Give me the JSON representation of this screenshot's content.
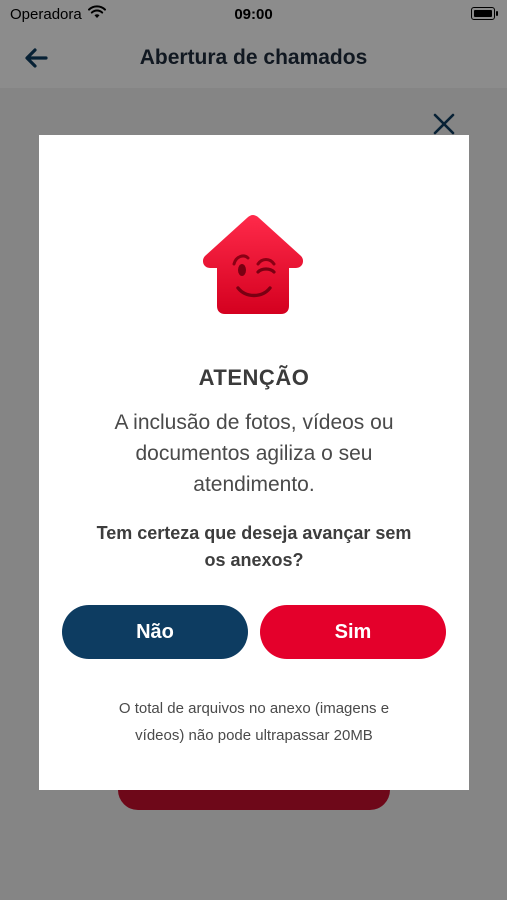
{
  "status_bar": {
    "carrier": "Operadora",
    "time": "09:00"
  },
  "header": {
    "title": "Abertura de chamados"
  },
  "dialog": {
    "title": "ATENÇÃO",
    "body_lines": [
      "A inclusão de fotos, vídeos ou",
      "documentos agiliza o seu",
      "atendimento."
    ],
    "question_lines": [
      "Tem certeza que deseja avançar sem",
      "os anexos?"
    ],
    "no_label": "Não",
    "yes_label": "Sim",
    "note_lines": [
      "O total de arquivos no anexo (imagens e",
      "vídeos) não pode ultrapassar 20MB"
    ]
  },
  "colors": {
    "brand_red": "#e4002b",
    "brand_navy": "#0d3c61"
  },
  "icons": {
    "mascot": "winking-house-icon",
    "back": "back-arrow-icon",
    "close": "close-icon"
  }
}
